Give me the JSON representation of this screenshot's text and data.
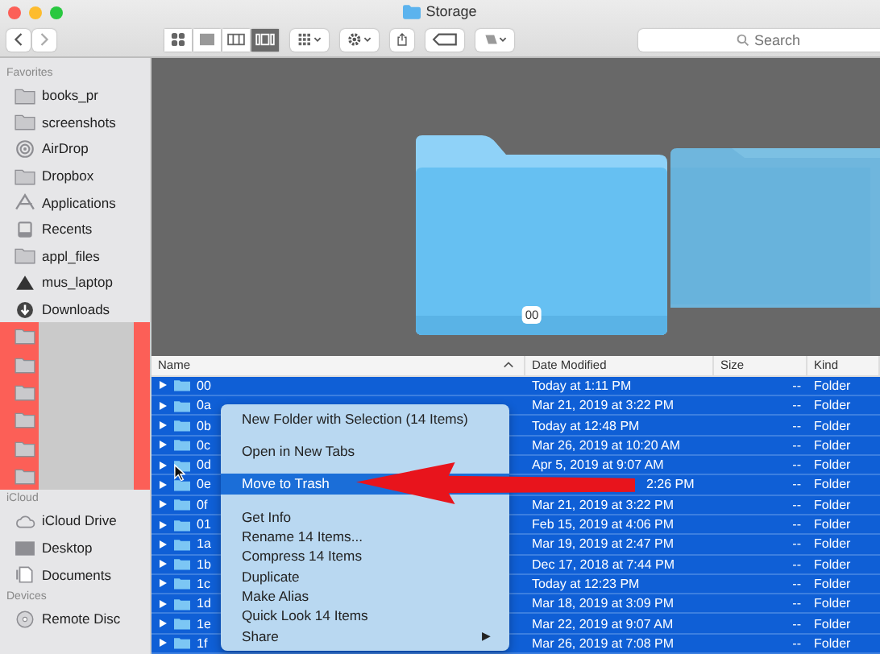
{
  "window": {
    "title": "Storage"
  },
  "toolbar": {
    "view_buttons": [
      {
        "kind": "icons",
        "selected": false
      },
      {
        "kind": "list",
        "selected": false
      },
      {
        "kind": "columns",
        "selected": false
      },
      {
        "kind": "coverflow",
        "selected": true
      }
    ],
    "search": {
      "placeholder": "Search"
    }
  },
  "sidebar": {
    "sections": [
      {
        "title": "Favorites",
        "items": [
          {
            "label": "books_pr",
            "kind": "folder"
          },
          {
            "label": "screenshots",
            "kind": "folder"
          },
          {
            "label": "AirDrop",
            "kind": "airdrop"
          },
          {
            "label": "Dropbox",
            "kind": "folder"
          },
          {
            "label": "Applications",
            "kind": "applications"
          },
          {
            "label": "Recents",
            "kind": "recents"
          },
          {
            "label": "appl_files",
            "kind": "folder"
          },
          {
            "label": "mus_laptop",
            "kind": "drive"
          },
          {
            "label": "Downloads",
            "kind": "downloads"
          },
          {
            "kind": "hidden"
          },
          {
            "kind": "hidden"
          },
          {
            "kind": "hidden"
          },
          {
            "kind": "hidden"
          },
          {
            "kind": "hidden"
          },
          {
            "kind": "hidden"
          }
        ]
      },
      {
        "title": "iCloud",
        "items": [
          {
            "label": "iCloud Drive",
            "kind": "cloud"
          },
          {
            "label": "Desktop",
            "kind": "desktop"
          },
          {
            "label": "Documents",
            "kind": "documents"
          }
        ]
      },
      {
        "title": "Devices",
        "items": [
          {
            "label": "Remote Disc",
            "kind": "disc"
          }
        ]
      }
    ]
  },
  "coverflow": {
    "caption": "00"
  },
  "table": {
    "columns": [
      "Name",
      "Date Modified",
      "Size",
      "Kind"
    ],
    "rows": [
      {
        "name": "00",
        "date": "Today at 1:11 PM",
        "size": "--",
        "kind": "Folder",
        "selected": true
      },
      {
        "name": "0a",
        "date": "Mar 21, 2019 at 3:22 PM",
        "size": "--",
        "kind": "Folder",
        "selected": true
      },
      {
        "name": "0b",
        "date": "Today at 12:48 PM",
        "size": "--",
        "kind": "Folder",
        "selected": true
      },
      {
        "name": "0c",
        "date": "Mar 26, 2019 at 10:20 AM",
        "size": "--",
        "kind": "Folder",
        "selected": true
      },
      {
        "name": "0d",
        "date": "Apr 5, 2019 at 9:07 AM",
        "size": "--",
        "kind": "Folder",
        "selected": true
      },
      {
        "name": "0e",
        "date": "2:26 PM",
        "date_covered": true,
        "size": "--",
        "kind": "Folder",
        "selected": true
      },
      {
        "name": "0f",
        "date": "Mar 21, 2019 at 3:22 PM",
        "size": "--",
        "kind": "Folder",
        "selected": true
      },
      {
        "name": "01",
        "date": "Feb 15, 2019 at 4:06 PM",
        "size": "--",
        "kind": "Folder",
        "selected": true
      },
      {
        "name": "1a",
        "date": "Mar 19, 2019 at 2:47 PM",
        "size": "--",
        "kind": "Folder",
        "selected": true
      },
      {
        "name": "1b",
        "date": "Dec 17, 2018 at 7:44 PM",
        "size": "--",
        "kind": "Folder",
        "selected": true
      },
      {
        "name": "1c",
        "date": "Today at 12:23 PM",
        "size": "--",
        "kind": "Folder",
        "selected": true
      },
      {
        "name": "1d",
        "date": "Mar 18, 2019 at 3:09 PM",
        "size": "--",
        "kind": "Folder",
        "selected": true
      },
      {
        "name": "1e",
        "date": "Mar 22, 2019 at 9:07 AM",
        "size": "--",
        "kind": "Folder",
        "selected": true
      },
      {
        "name": "1f",
        "date": "Mar 26, 2019 at 7:08 PM",
        "size": "--",
        "kind": "Folder",
        "selected": true
      }
    ]
  },
  "context_menu": {
    "items": [
      {
        "kind": "item",
        "label": "New Folder with Selection (14 Items)",
        "selected": false
      },
      {
        "kind": "separator"
      },
      {
        "kind": "item",
        "label": "Open in New Tabs",
        "selected": false
      },
      {
        "kind": "separator"
      },
      {
        "kind": "item",
        "label": "Move to Trash",
        "selected": true
      },
      {
        "kind": "separator"
      },
      {
        "kind": "item",
        "label": "Get Info",
        "selected": false
      },
      {
        "kind": "item",
        "label": "Rename 14 Items...",
        "selected": false
      },
      {
        "kind": "item",
        "label": "Compress 14 Items",
        "selected": false
      },
      {
        "kind": "item",
        "label": "Duplicate",
        "selected": false
      },
      {
        "kind": "item",
        "label": "Make Alias",
        "selected": false
      },
      {
        "kind": "item",
        "label": "Quick Look 14 Items",
        "selected": false
      },
      {
        "kind": "item",
        "label": "Share",
        "selected": false,
        "arrow": "▶"
      }
    ]
  }
}
